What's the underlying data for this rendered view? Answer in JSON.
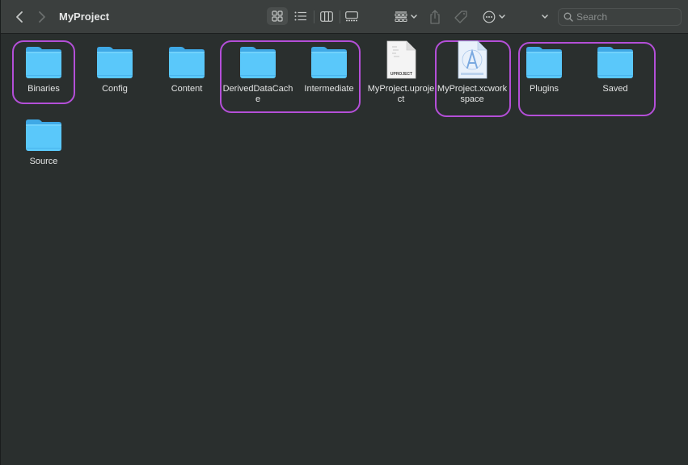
{
  "window": {
    "title": "MyProject"
  },
  "toolbar": {
    "back_icon": "chevron-left-icon",
    "forward_icon": "chevron-right-icon",
    "views": [
      {
        "name": "icon-view",
        "icon": "grid-icon",
        "active": true
      },
      {
        "name": "list-view",
        "icon": "list-icon",
        "active": false
      },
      {
        "name": "column-view",
        "icon": "columns-icon",
        "active": false
      },
      {
        "name": "gallery-view",
        "icon": "gallery-icon",
        "active": false
      }
    ],
    "group_icon": "group-by-icon",
    "share_icon": "share-icon",
    "tag_icon": "tag-icon",
    "more_icon": "ellipsis-circle-icon",
    "expand_icon": "chevron-down-icon",
    "search": {
      "placeholder": "Search",
      "value": ""
    }
  },
  "items": [
    {
      "label": "Binaries",
      "kind": "folder",
      "highlighted": true
    },
    {
      "label": "Config",
      "kind": "folder",
      "highlighted": false
    },
    {
      "label": "Content",
      "kind": "folder",
      "highlighted": false
    },
    {
      "label": "DerivedDataCache",
      "kind": "folder",
      "highlighted": true
    },
    {
      "label": "Intermediate",
      "kind": "folder",
      "highlighted": true
    },
    {
      "label": "MyProject.uproject",
      "kind": "uproject",
      "badge": "UPROJECT",
      "highlighted": false
    },
    {
      "label": "MyProject.xcworkspace",
      "kind": "xcworkspace",
      "highlighted": true
    },
    {
      "label": "Plugins",
      "kind": "folder",
      "highlighted": true
    },
    {
      "label": "Saved",
      "kind": "folder",
      "highlighted": true
    },
    {
      "label": "Source",
      "kind": "folder",
      "highlighted": false
    }
  ],
  "colors": {
    "highlight": "#b44fd8",
    "folder": "#5ac8fa",
    "background": "#2a2f2e",
    "toolbar": "#3b3f3e"
  }
}
